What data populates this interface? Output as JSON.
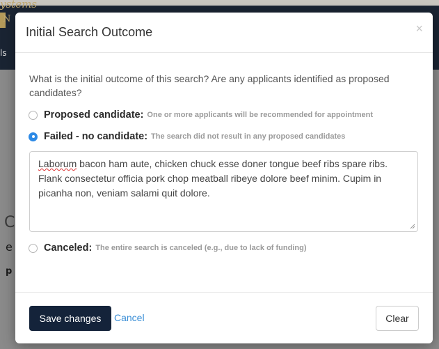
{
  "background": {
    "brand_script": "ystems",
    "brand_letter": "N",
    "nav_fragment": "ls",
    "heading_fragment": "C",
    "line_fragment": "e",
    "bold_fragment": "p"
  },
  "modal": {
    "title": "Initial Search Outcome",
    "close_label": "×",
    "prompt": "What is the initial outcome of this search? Are any applicants identified as proposed candidates?",
    "options": [
      {
        "label": "Proposed candidate:",
        "description": "One or more applicants will be recommended for appointment",
        "selected": false
      },
      {
        "label": "Failed - no candidate:",
        "description": "The search did not result in any proposed candidates",
        "selected": true
      },
      {
        "label": "Canceled:",
        "description": "The entire search is canceled (e.g., due to lack of funding)",
        "selected": false
      }
    ],
    "comment": {
      "misspelled_word": "Laborum",
      "rest": " bacon ham aute, chicken chuck esse doner tongue beef ribs spare ribs.  Flank consectetur officia pork chop meatball ribeye dolore beef minim. Cupim in picanha non, veniam salami quit dolore."
    },
    "footer": {
      "save_label": "Save changes",
      "cancel_label": "Cancel",
      "clear_label": "Clear"
    }
  },
  "colors": {
    "primary_button": "#14233a",
    "link": "#3a8ed6",
    "radio_selected": "#2d8ae6"
  }
}
